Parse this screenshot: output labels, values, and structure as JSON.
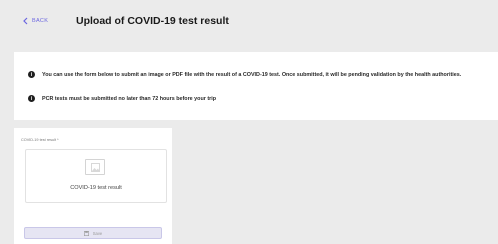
{
  "header": {
    "back_label": "BACK",
    "title": "Upload of COVID-19 test result"
  },
  "info": {
    "line1": "You can use the form below to submit an image or PDF file with the result of a COVID-19 test. Once submitted, it will be pending validation by the health authorities.",
    "line2": "PCR tests must be submitted no later than 72 hours before your trip"
  },
  "form": {
    "field_label": "COVID-19 test result *",
    "upload_label": "COVID-19 test result",
    "save_label": "Save"
  },
  "colors": {
    "accent": "#6b66e0",
    "background": "#ebebeb",
    "save_button_bg": "#e6e5f3"
  }
}
